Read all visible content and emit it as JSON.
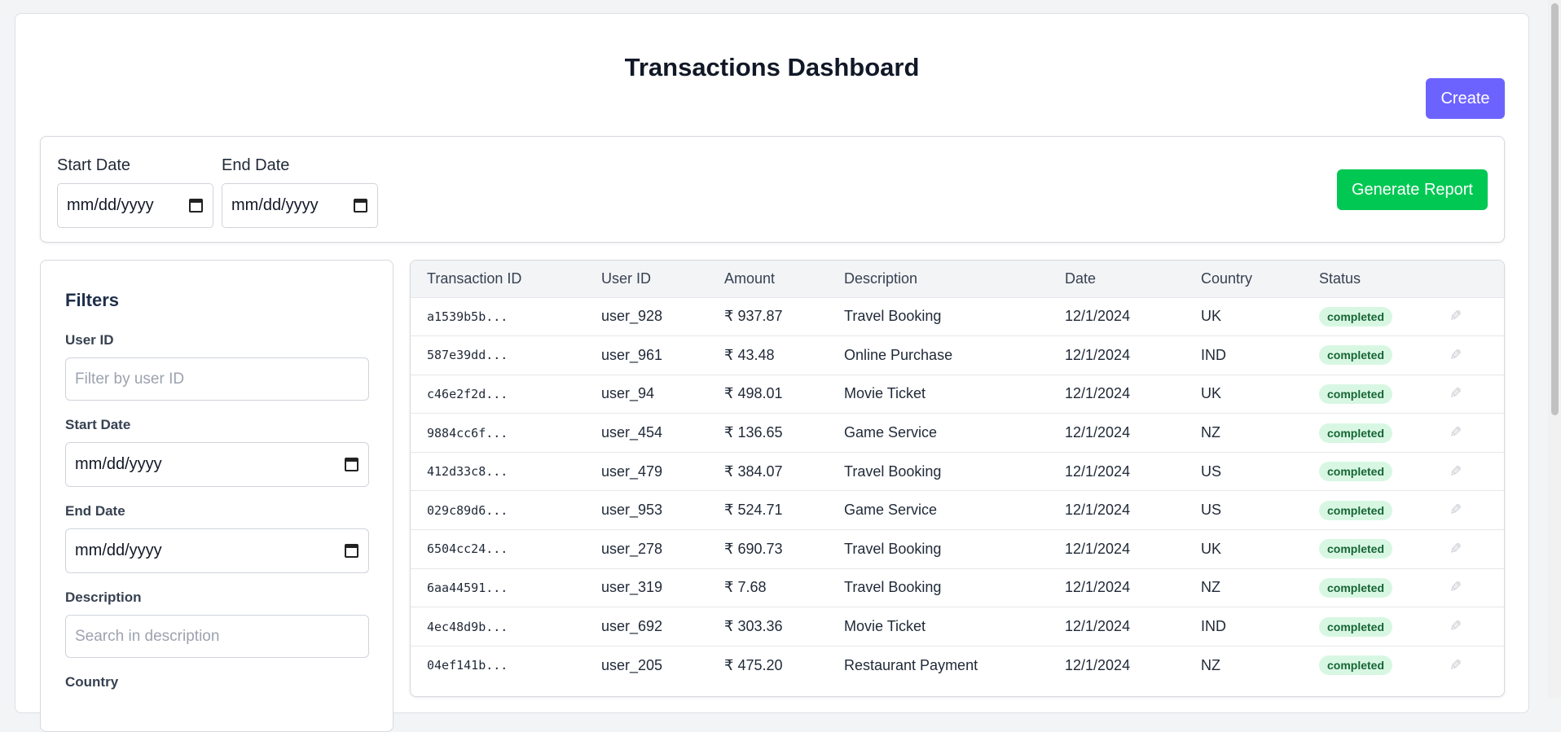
{
  "header": {
    "title": "Transactions Dashboard",
    "create_label": "Create"
  },
  "report": {
    "start_label": "Start Date",
    "end_label": "End Date",
    "date_placeholder": "mm/dd/yyyy",
    "generate_label": "Generate Report"
  },
  "filters": {
    "title": "Filters",
    "user_id_label": "User ID",
    "user_id_placeholder": "Filter by user ID",
    "start_label": "Start Date",
    "end_label": "End Date",
    "date_placeholder": "mm/dd/yyyy",
    "description_label": "Description",
    "description_placeholder": "Search in description",
    "country_label": "Country"
  },
  "table": {
    "columns": [
      "Transaction ID",
      "User ID",
      "Amount",
      "Description",
      "Date",
      "Country",
      "Status"
    ],
    "rows": [
      {
        "id": "a1539b5b...",
        "user": "user_928",
        "amount": "₹ 937.87",
        "desc": "Travel Booking",
        "date": "12/1/2024",
        "country": "UK",
        "status": "completed"
      },
      {
        "id": "587e39dd...",
        "user": "user_961",
        "amount": "₹ 43.48",
        "desc": "Online Purchase",
        "date": "12/1/2024",
        "country": "IND",
        "status": "completed"
      },
      {
        "id": "c46e2f2d...",
        "user": "user_94",
        "amount": "₹ 498.01",
        "desc": "Movie Ticket",
        "date": "12/1/2024",
        "country": "UK",
        "status": "completed"
      },
      {
        "id": "9884cc6f...",
        "user": "user_454",
        "amount": "₹ 136.65",
        "desc": "Game Service",
        "date": "12/1/2024",
        "country": "NZ",
        "status": "completed"
      },
      {
        "id": "412d33c8...",
        "user": "user_479",
        "amount": "₹ 384.07",
        "desc": "Travel Booking",
        "date": "12/1/2024",
        "country": "US",
        "status": "completed"
      },
      {
        "id": "029c89d6...",
        "user": "user_953",
        "amount": "₹ 524.71",
        "desc": "Game Service",
        "date": "12/1/2024",
        "country": "US",
        "status": "completed"
      },
      {
        "id": "6504cc24...",
        "user": "user_278",
        "amount": "₹ 690.73",
        "desc": "Travel Booking",
        "date": "12/1/2024",
        "country": "UK",
        "status": "completed"
      },
      {
        "id": "6aa44591...",
        "user": "user_319",
        "amount": "₹ 7.68",
        "desc": "Travel Booking",
        "date": "12/1/2024",
        "country": "NZ",
        "status": "completed"
      },
      {
        "id": "4ec48d9b...",
        "user": "user_692",
        "amount": "₹ 303.36",
        "desc": "Movie Ticket",
        "date": "12/1/2024",
        "country": "IND",
        "status": "completed"
      },
      {
        "id": "04ef141b...",
        "user": "user_205",
        "amount": "₹ 475.20",
        "desc": "Restaurant Payment",
        "date": "12/1/2024",
        "country": "NZ",
        "status": "completed"
      }
    ]
  },
  "colors": {
    "create_button": "#6c63ff",
    "generate_button": "#00c853",
    "status_badge_bg": "#d8f7e3",
    "status_badge_text": "#166534"
  },
  "icons": {
    "date_picker": "calendar-icon",
    "row_action": "pencil-edit-icon"
  }
}
